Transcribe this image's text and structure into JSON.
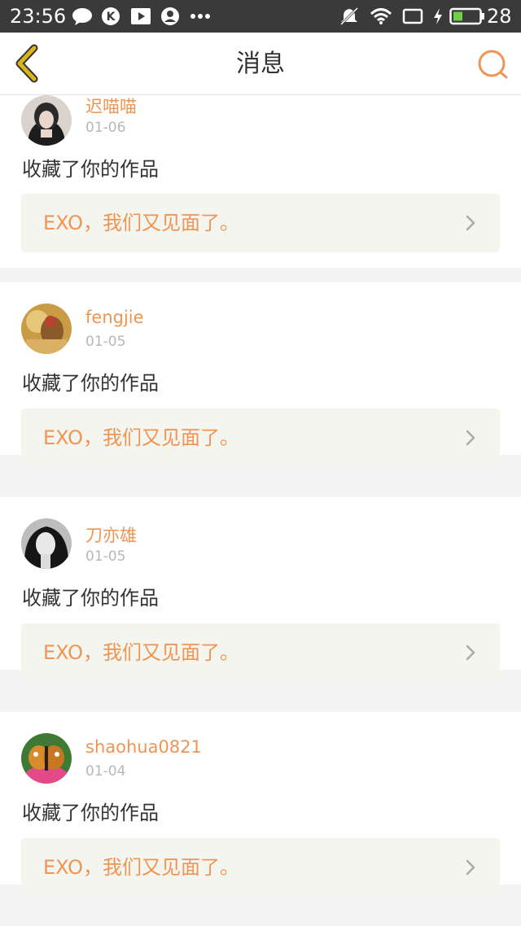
{
  "status_bar": {
    "time": "23:56",
    "battery_percent": "28",
    "icons": [
      "chat-bubble-icon",
      "k-app-icon",
      "play-icon",
      "user-circle-icon",
      "more-dots-icon",
      "mute-icon",
      "wifi-icon",
      "screen-icon",
      "charging-icon",
      "battery-icon"
    ]
  },
  "nav": {
    "title": "消息",
    "back_icon": "chevron-left-icon",
    "search_icon": "search-icon"
  },
  "colors": {
    "accent": "#ef9554",
    "back_icon": "#d9b51c"
  },
  "messages": [
    {
      "username": "迟喵喵",
      "date": "01-06",
      "action": "收藏了你的作品",
      "work_title": "EXO，我们又见面了。"
    },
    {
      "username": "fengjie",
      "date": "01-05",
      "action": "收藏了你的作品",
      "work_title": "EXO，我们又见面了。"
    },
    {
      "username": "刀亦雄",
      "date": "01-05",
      "action": "收藏了你的作品",
      "work_title": "EXO，我们又见面了。"
    },
    {
      "username": "shaohua0821",
      "date": "01-04",
      "action": "收藏了你的作品",
      "work_title": "EXO，我们又见面了。"
    }
  ]
}
